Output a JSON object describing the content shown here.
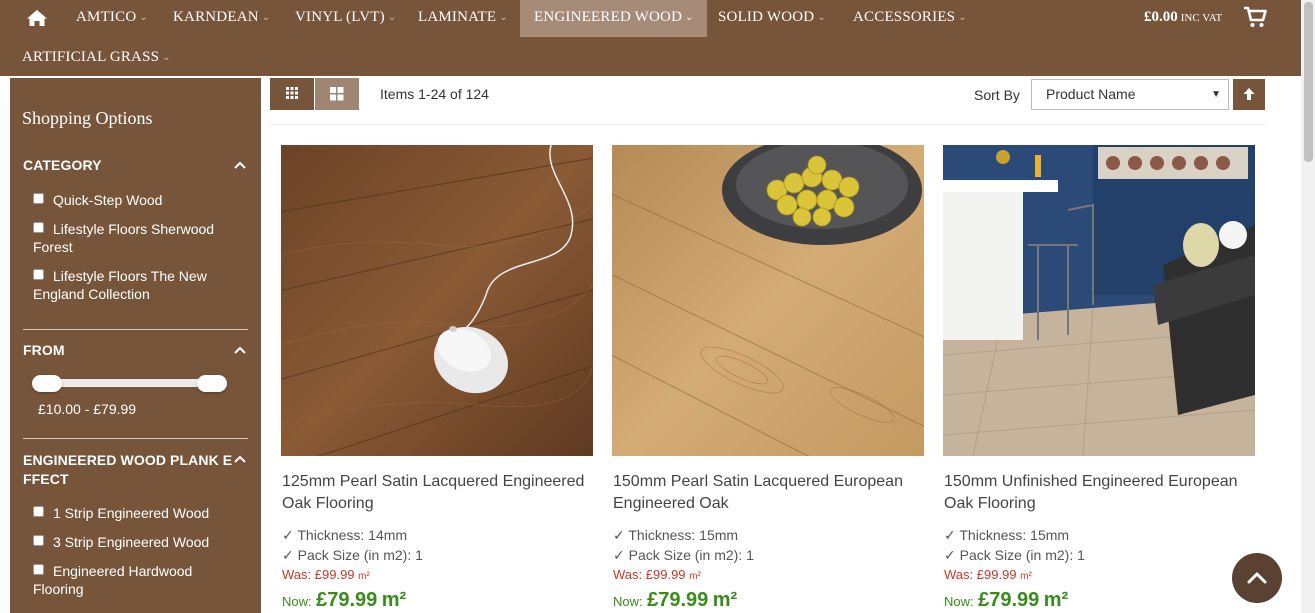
{
  "nav": {
    "items": [
      {
        "label": "AMTICO"
      },
      {
        "label": "KARNDEAN"
      },
      {
        "label": "VINYL (LVT)"
      },
      {
        "label": "LAMINATE"
      },
      {
        "label": "ENGINEERED WOOD"
      },
      {
        "label": "SOLID WOOD"
      },
      {
        "label": "ACCESSORIES"
      },
      {
        "label": "ARTIFICIAL GRASS"
      }
    ],
    "active": "ENGINEERED WOOD",
    "chevron": "⌄",
    "cart_total": "£0.00",
    "cart_vat": "INC VAT"
  },
  "sidebar": {
    "title": "Shopping Options",
    "category": {
      "heading": "CATEGORY",
      "options": [
        "Quick-Step Wood",
        "Lifestyle Floors Sherwood Forest",
        "Lifestyle Floors The New England Collection"
      ]
    },
    "from": {
      "heading": "FROM",
      "range_text": "£10.00 - £79.99"
    },
    "plank_effect": {
      "heading": "ENGINEERED WOOD PLANK EFFECT",
      "heading_line1": "ENGINEERED WOOD PLANK E",
      "heading_line2": "FFECT",
      "options": [
        "1 Strip Engineered Wood",
        "3 Strip Engineered Wood",
        "Engineered Hardwood Flooring"
      ]
    }
  },
  "toolbar": {
    "items_text": "Items 1-24 of 124",
    "sort_label": "Sort By",
    "sort_value": "Product Name",
    "sort_arrow": "▼"
  },
  "products": [
    {
      "name": "125mm Pearl Satin Lacquered Engineered Oak Flooring",
      "thickness": "✓ Thickness: 14mm",
      "pack_size": "✓ Pack Size (in m2): 1",
      "was_label": "Was:",
      "was_price": "£99.99",
      "was_unit": "m²",
      "now_label": "Now:",
      "now_price": "£79.99",
      "now_unit": "m²"
    },
    {
      "name": "150mm Pearl Satin Lacquered European Engineered Oak",
      "thickness": "✓ Thickness: 15mm",
      "pack_size": "✓ Pack Size (in m2): 1",
      "was_label": "Was:",
      "was_price": "£99.99",
      "was_unit": "m²",
      "now_label": "Now:",
      "now_price": "£79.99",
      "now_unit": "m²"
    },
    {
      "name": "150mm Unfinished Engineered European Oak Flooring",
      "thickness": "✓ Thickness: 15mm",
      "pack_size": "✓ Pack Size (in m2): 1",
      "was_label": "Was:",
      "was_price": "£99.99",
      "was_unit": "m²",
      "now_label": "Now:",
      "now_price": "£79.99",
      "now_unit": "m²"
    }
  ],
  "colors": {
    "brand_brown": "#77553b",
    "active_tab": "#a68b77",
    "price_green": "#3a8a1e",
    "was_red": "#c0392b"
  },
  "icons": {
    "home": "home-icon",
    "cart": "cart-icon",
    "grid_mode": "grid-icon",
    "list_mode": "list-icon",
    "sort_direction": "arrow-up-icon",
    "back_to_top": "chevron-up-icon"
  }
}
